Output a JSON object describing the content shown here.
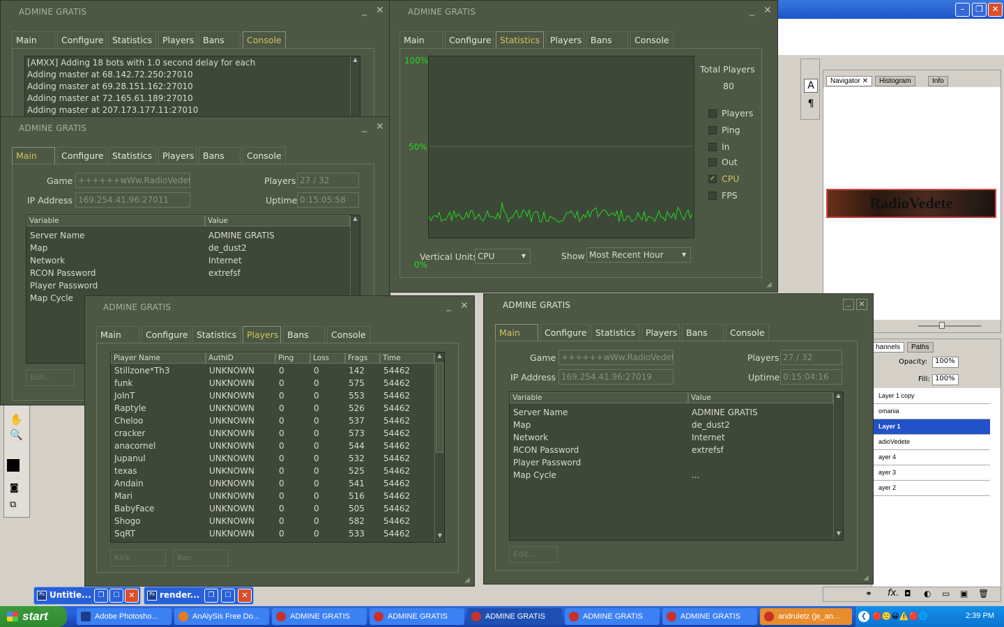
{
  "app_title": "ADMINE GRATIS",
  "tabs": [
    "Main",
    "Configure",
    "Statistics",
    "Players",
    "Bans",
    "Console"
  ],
  "console": {
    "lines": [
      "[AMXX] Adding 18 bots with 1.0 second delay for each",
      "Adding master at 68.142.72.250:27010",
      "Adding master at 69.28.151.162:27010",
      "Adding master at 72.165.61.189:27010",
      "Adding master at 207.173.177.11:27010"
    ]
  },
  "main1": {
    "game_label": "Game",
    "game_value": "++++++wWw.RadioVedete.",
    "ip_label": "IP Address",
    "ip_value": "169.254.41.96:27011",
    "players_label": "Players",
    "players_value": "27 / 32",
    "uptime_label": "Uptime",
    "uptime_value": "0:15:05:58",
    "var_header": "Variable",
    "val_header": "Value",
    "rows": [
      {
        "k": "Server Name",
        "v": "ADMINE GRATIS"
      },
      {
        "k": "Map",
        "v": "de_dust2"
      },
      {
        "k": "Network",
        "v": "Internet"
      },
      {
        "k": "RCON Password",
        "v": "extrefsf"
      },
      {
        "k": "Player Password",
        "v": ""
      },
      {
        "k": "Map Cycle",
        "v": ""
      }
    ],
    "edit_label": "Edit..."
  },
  "stats": {
    "y_top": "100%",
    "y_mid": "50%",
    "y_bot": "0%",
    "total_label": "Total Players",
    "total_value": "80",
    "checks": [
      {
        "label": "Players",
        "checked": false
      },
      {
        "label": "Ping",
        "checked": false
      },
      {
        "label": "In",
        "checked": false
      },
      {
        "label": "Out",
        "checked": false
      },
      {
        "label": "CPU",
        "checked": true
      },
      {
        "label": "FPS",
        "checked": false
      }
    ],
    "vunits_label": "Vertical Units",
    "vunits_value": "CPU",
    "show_label": "Show",
    "show_value": "Most Recent Hour",
    "colors": {
      "line": "#22d822",
      "active": "#d0c45c"
    }
  },
  "players": {
    "headers": [
      "Player Name",
      "AuthID",
      "Ping",
      "Loss",
      "Frags",
      "Time"
    ],
    "rows": [
      [
        "Stillzone*Th3",
        "UNKNOWN",
        "0",
        "0",
        "142",
        "54462"
      ],
      [
        "funk",
        "UNKNOWN",
        "0",
        "0",
        "575",
        "54462"
      ],
      [
        "JoInT",
        "UNKNOWN",
        "0",
        "0",
        "553",
        "54462"
      ],
      [
        "Raptyle",
        "UNKNOWN",
        "0",
        "0",
        "526",
        "54462"
      ],
      [
        "Cheloo",
        "UNKNOWN",
        "0",
        "0",
        "537",
        "54462"
      ],
      [
        "cracker",
        "UNKNOWN",
        "0",
        "0",
        "573",
        "54462"
      ],
      [
        "anacornel",
        "UNKNOWN",
        "0",
        "0",
        "544",
        "54462"
      ],
      [
        "Jupanul",
        "UNKNOWN",
        "0",
        "0",
        "532",
        "54462"
      ],
      [
        "texas",
        "UNKNOWN",
        "0",
        "0",
        "525",
        "54462"
      ],
      [
        "Andain",
        "UNKNOWN",
        "0",
        "0",
        "541",
        "54462"
      ],
      [
        "Mari",
        "UNKNOWN",
        "0",
        "0",
        "516",
        "54462"
      ],
      [
        "BabyFace",
        "UNKNOWN",
        "0",
        "0",
        "505",
        "54462"
      ],
      [
        "Shogo",
        "UNKNOWN",
        "0",
        "0",
        "582",
        "54462"
      ],
      [
        "SqRT",
        "UNKNOWN",
        "0",
        "0",
        "533",
        "54462"
      ]
    ],
    "kick_label": "Kick",
    "ban_label": "Ban"
  },
  "main2": {
    "game_label": "Game",
    "game_value": "++++++wWw.RadioVedete.",
    "ip_label": "IP Address",
    "ip_value": "169.254.41.96:27019",
    "players_label": "Players",
    "players_value": "27 / 32",
    "uptime_label": "Uptime",
    "uptime_value": "0:15:04:16",
    "var_header": "Variable",
    "val_header": "Value",
    "rows": [
      {
        "k": "Server Name",
        "v": "ADMINE GRATIS"
      },
      {
        "k": "Map",
        "v": "de_dust2"
      },
      {
        "k": "Network",
        "v": "Internet"
      },
      {
        "k": "RCON Password",
        "v": "extrefsf"
      },
      {
        "k": "Player Password",
        "v": ""
      },
      {
        "k": "Map Cycle",
        "v": "..."
      }
    ],
    "edit_label": "Edit..."
  },
  "photoshop": {
    "nav_tabs": [
      "Navigator",
      "Histogram",
      "Info"
    ],
    "layer_tabs": [
      "hannels",
      "Paths"
    ],
    "opacity_label": "Opacity:",
    "opacity_value": "100%",
    "fill_label": "Fill:",
    "fill_value": "100%",
    "layers": [
      {
        "name": "Layer 1 copy",
        "selected": false
      },
      {
        "name": "omania",
        "selected": false
      },
      {
        "name": "Layer 1",
        "selected": true
      },
      {
        "name": "adioVedete",
        "selected": false
      },
      {
        "name": "ayer 4",
        "selected": false
      },
      {
        "name": "ayer 3",
        "selected": false
      },
      {
        "name": "ayer 2",
        "selected": false
      }
    ],
    "banner_text": "RadioVedete"
  },
  "mini_windows": [
    "Untitle...",
    "render..."
  ],
  "taskbar": {
    "start_label": "start",
    "items": [
      {
        "label": "Adobe Photosho...",
        "active": false
      },
      {
        "label": "AnAlySis Free Do...",
        "active": false
      },
      {
        "label": "ADMINE GRATIS",
        "active": false
      },
      {
        "label": "ADMINE GRATIS",
        "active": false
      },
      {
        "label": "ADMINE GRATIS",
        "active": true
      },
      {
        "label": "ADMINE GRATIS",
        "active": false
      },
      {
        "label": "ADMINE GRATIS",
        "active": false
      },
      {
        "label": "andruletz (je_an...",
        "active": false
      }
    ],
    "clock": "2:39 PM"
  }
}
